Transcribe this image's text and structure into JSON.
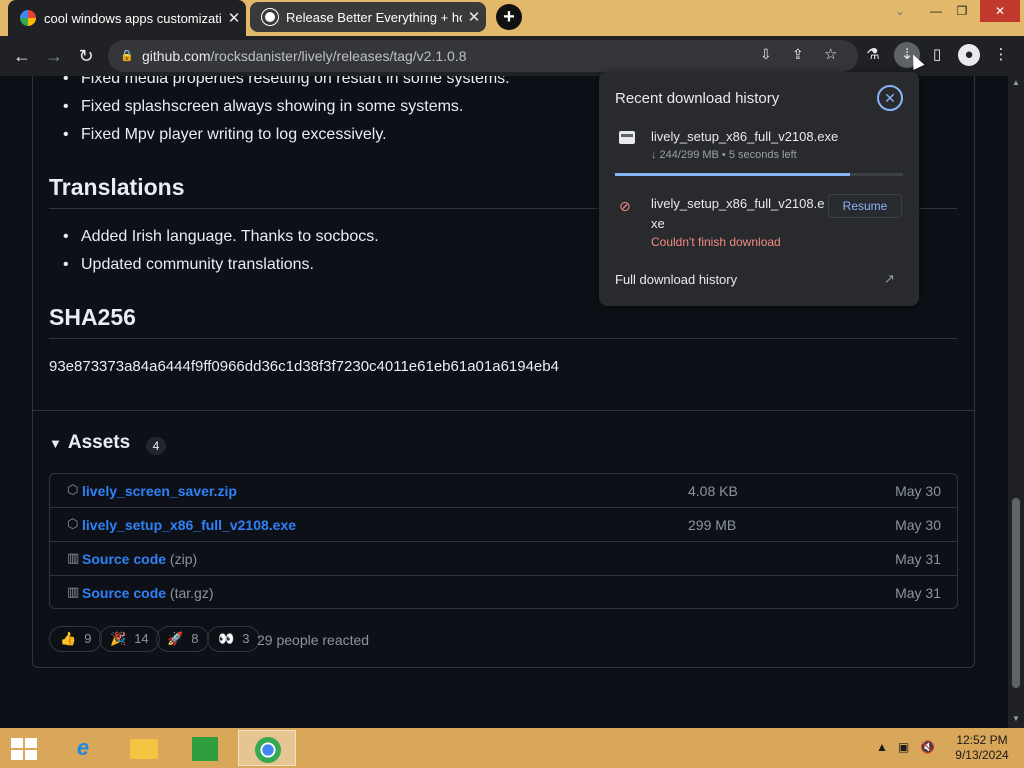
{
  "tabs": [
    {
      "title": "cool windows apps customizatio",
      "close": "✕"
    },
    {
      "title": "Release Better Everything + hotf",
      "close": "✕"
    }
  ],
  "new_tab": "+",
  "window_controls": {
    "minimize": "—",
    "restore": "❐",
    "close": "✕",
    "chevron": "⌄"
  },
  "address": {
    "domain": "github.com",
    "path": "/rocksdanister/lively/releases/tag/v2.1.0.8"
  },
  "release": {
    "fixed_bullets": [
      "Fixed media properties resetting on restart in some systems.",
      "Fixed splashscreen always showing in some systems.",
      "Fixed Mpv player writing to log excessively."
    ],
    "translations_heading": "Translations",
    "translations_bullets": [
      "Added Irish language. Thanks to socbocs.",
      "Updated community translations."
    ],
    "sha_heading": "SHA256",
    "sha_value": "93e873373a84a6444f9ff0966dd36c1d38f3f7230c4011e61eb61a01a6194eb4"
  },
  "assets": {
    "heading": "Assets",
    "count": "4",
    "rows": [
      {
        "name": "lively_screen_saver.zip",
        "sub": "",
        "size": "4.08 KB",
        "date": "May 30",
        "icon": "package-icon"
      },
      {
        "name": "lively_setup_x86_full_v2108.exe",
        "sub": "",
        "size": "299 MB",
        "date": "May 30",
        "icon": "package-icon"
      },
      {
        "name": "Source code",
        "sub": " (zip)",
        "size": "",
        "date": "May 31",
        "icon": "file-zip-icon"
      },
      {
        "name": "Source code",
        "sub": " (tar.gz)",
        "size": "",
        "date": "May 31",
        "icon": "file-zip-icon"
      }
    ]
  },
  "reactions": [
    {
      "emoji": "👍",
      "count": "9"
    },
    {
      "emoji": "🎉",
      "count": "14"
    },
    {
      "emoji": "🚀",
      "count": "8"
    },
    {
      "emoji": "👀",
      "count": "3"
    }
  ],
  "reacted_text": "29 people reacted",
  "downloads": {
    "title": "Recent download history",
    "item1": {
      "file": "lively_setup_x86_full_v2108.exe",
      "status": "↓ 244/299 MB • 5 seconds left",
      "progress": 0.816
    },
    "item2": {
      "file_line1": "lively_setup_x86_full_v2108.e",
      "file_line2": "xe",
      "button": "Resume",
      "error": "Couldn't finish download"
    },
    "full_history": "Full download history"
  },
  "taskbar": {
    "time": "12:52 PM",
    "date": "9/13/2024"
  },
  "colors": {
    "accent_link": "#2f81f7",
    "progress": "#8ab4f8",
    "error": "#f28b82",
    "tabbar": "#e2b96b"
  }
}
